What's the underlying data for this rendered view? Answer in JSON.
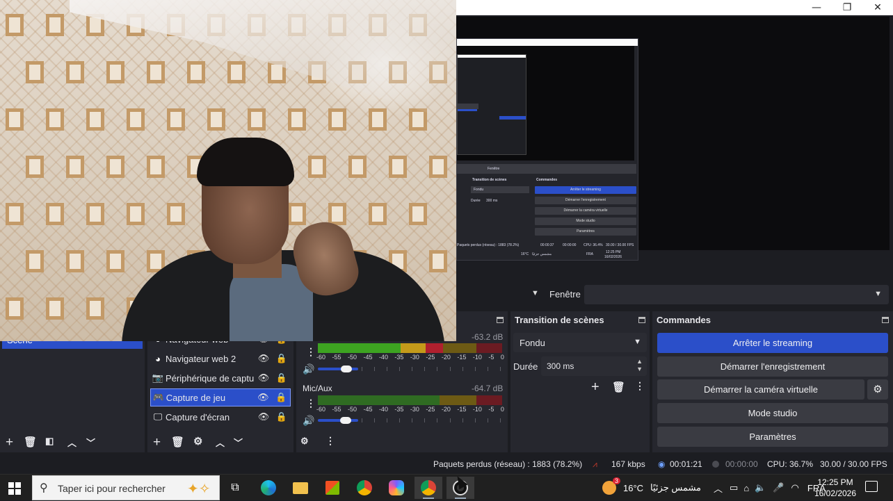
{
  "window": {
    "minimize": "—",
    "restore": "❐",
    "close": "✕"
  },
  "source_bar": {
    "label": "Fenêtre",
    "value": ""
  },
  "scenes": {
    "items": [
      "Scène"
    ]
  },
  "sources": {
    "items": [
      {
        "icon": "globe-icon",
        "name": "Navigateur web"
      },
      {
        "icon": "globe-icon",
        "name": "Navigateur web 2"
      },
      {
        "icon": "camera-icon",
        "name": "Périphérique de captu"
      },
      {
        "icon": "gamepad-icon",
        "name": "Capture de jeu",
        "selected": true
      },
      {
        "icon": "monitor-icon",
        "name": "Capture d'écran"
      }
    ]
  },
  "mixer": {
    "channels": [
      {
        "name": "",
        "db": "-63.2 dB",
        "level": 0.68
      },
      {
        "name": "Mic/Aux",
        "db": "-64.7 dB",
        "level": 0.0
      }
    ],
    "scale": [
      "-60",
      "-55",
      "-50",
      "-45",
      "-40",
      "-35",
      "-30",
      "-25",
      "-20",
      "-15",
      "-10",
      "-5",
      "0"
    ]
  },
  "transition": {
    "title": "Transition de scènes",
    "type": "Fondu",
    "duration_label": "Durée",
    "duration": "300 ms"
  },
  "commands": {
    "title": "Commandes",
    "stop_streaming": "Arrêter le streaming",
    "start_recording": "Démarrer l'enregistrement",
    "start_vcam": "Démarrer la caméra virtuelle",
    "studio_mode": "Mode studio",
    "settings": "Paramètres"
  },
  "status": {
    "dropped": "Paquets perdus (réseau) : 1883 (78.2%)",
    "bitrate": "167 kbps",
    "live_time": "00:01:21",
    "rec_time": "00:00:00",
    "cpu": "CPU: 36.7%",
    "fps": "30.00 / 30.00 FPS"
  },
  "nested": {
    "transition": "Transition de scènes",
    "commands": "Commandes",
    "window": "Fenêtre",
    "fondu": "Fondu",
    "duree": "Durée",
    "duree_val": "300 ms",
    "btn1": "Arrêter le streaming",
    "btn2": "Démarrer l'enregistrement",
    "btn3": "Démarrer la caméra virtuelle",
    "btn4": "Mode studio",
    "btn5": "Paramètres",
    "status_left": "Paquets perdus (réseau) : 1883 (78.2%)",
    "status_time": "00:00:37",
    "status_rec": "00:00:00",
    "status_cpu": "CPU: 36.4%",
    "status_fps": "30.00 / 30.00 FPS",
    "tb_weather": "16°C",
    "tb_ar": "مشمس جزئيًا",
    "tb_lang": "FRA",
    "tb_time": "12:25 PM",
    "tb_date": "16/02/2026"
  },
  "taskbar": {
    "search_placeholder": "Taper ici pour rechercher",
    "weather_temp": "16°C",
    "weather_text": "مشمس جزئيًا",
    "weather_badge": "3",
    "language": "FRA",
    "time": "12:25 PM",
    "date": "16/02/2026"
  }
}
